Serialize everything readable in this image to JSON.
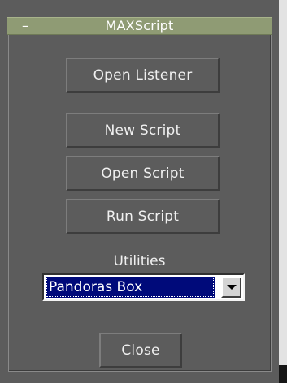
{
  "rollout": {
    "title": "MAXScript",
    "collapse_glyph": "–"
  },
  "buttons": {
    "open_listener": "Open Listener",
    "new_script": "New Script",
    "open_script": "Open Script",
    "run_script": "Run Script",
    "close": "Close"
  },
  "utilities": {
    "label": "Utilities",
    "selected": "Pandoras Box"
  },
  "colors": {
    "header_bg": "#8f9b74",
    "panel_bg": "#5c5c5c",
    "selection_bg": "#000a7a"
  },
  "icons": {
    "dropdown": "chevron-down-icon"
  }
}
